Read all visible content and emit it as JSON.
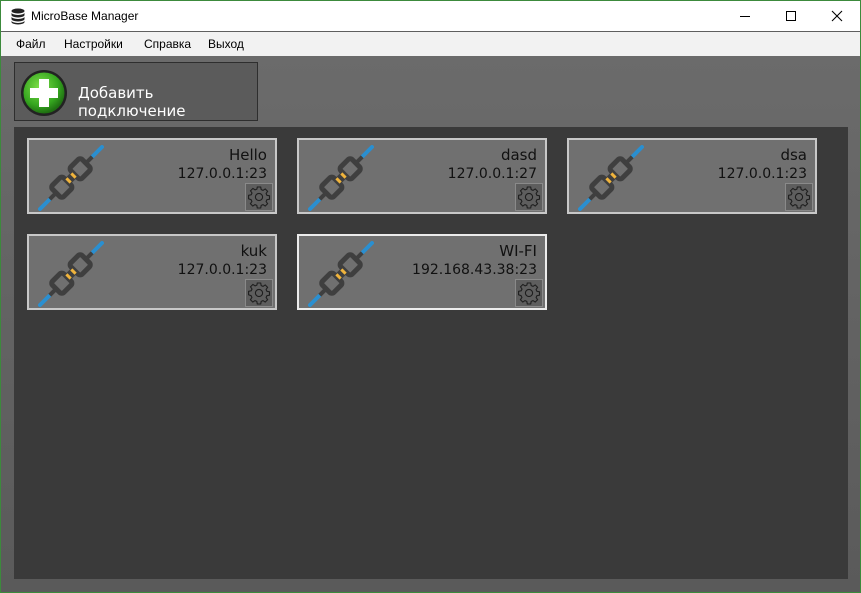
{
  "window": {
    "title": "MicroBase Manager"
  },
  "menu": {
    "items": [
      "Файл",
      "Настройки",
      "Справка",
      "Выход"
    ]
  },
  "toolbar": {
    "add_label": "Добавить подключение"
  },
  "connections": [
    {
      "name": "Hello",
      "address": "127.0.0.1:23"
    },
    {
      "name": "dasd",
      "address": "127.0.0.1:27"
    },
    {
      "name": "dsa",
      "address": "127.0.0.1:23"
    },
    {
      "name": "kuk",
      "address": "127.0.0.1:23"
    },
    {
      "name": "WI-FI",
      "address": "192.168.43.38:23",
      "selected": true
    }
  ],
  "colors": {
    "plug_body": "#3f3f3f",
    "plug_accent": "#f0b43c",
    "plug_wire": "#2a8fd0",
    "add_green": "#3fae2a"
  }
}
